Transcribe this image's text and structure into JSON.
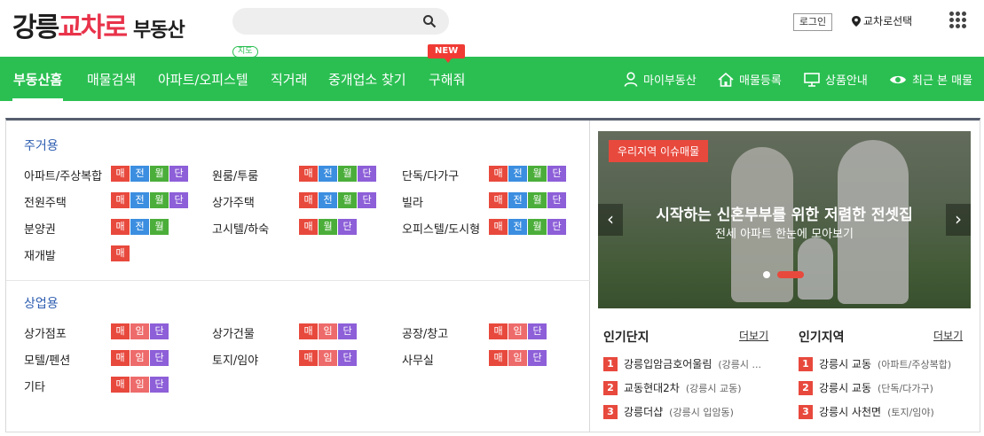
{
  "header": {
    "logo_part1": "강릉",
    "logo_part2": "교차로",
    "logo_part3": "부동산",
    "search_placeholder": "",
    "search_icon": "search-icon",
    "login_label": "로그인",
    "region_label": "교차로선택",
    "menu_icon": "grid-menu-icon"
  },
  "colors": {
    "brand_green": "#2bbf52",
    "brand_red": "#e8334a",
    "tag_sale": "#e8493d",
    "tag_jeonse": "#3c8ee0",
    "tag_monthly": "#4bae3a",
    "tag_short": "#8d5fd8",
    "tag_rent": "#ee6b6b",
    "section_blue": "#2d5db0"
  },
  "nav": {
    "items": [
      {
        "label": "부동산홈",
        "active": true
      },
      {
        "label": "매물검색"
      },
      {
        "label": "아파트/오피스텔",
        "badge": "지도"
      },
      {
        "label": "직거래"
      },
      {
        "label": "중개업소 찾기"
      },
      {
        "label": "구해줘",
        "badge": "NEW"
      }
    ],
    "right_items": [
      {
        "label": "마이부동산",
        "icon": "user-icon"
      },
      {
        "label": "매물등록",
        "icon": "house-icon"
      },
      {
        "label": "상품안내",
        "icon": "monitor-icon"
      },
      {
        "label": "최근 본 매물",
        "icon": "eye-icon"
      }
    ]
  },
  "residential": {
    "title": "주거용",
    "rows": [
      {
        "label": "아파트/주상복합",
        "tags": [
          "매",
          "전",
          "월",
          "단"
        ]
      },
      {
        "label": "원룸/투룸",
        "tags": [
          "매",
          "전",
          "월",
          "단"
        ]
      },
      {
        "label": "단독/다가구",
        "tags": [
          "매",
          "전",
          "월",
          "단"
        ]
      },
      {
        "label": "전원주택",
        "tags": [
          "매",
          "전",
          "월",
          "단"
        ]
      },
      {
        "label": "상가주택",
        "tags": [
          "매",
          "전",
          "월",
          "단"
        ]
      },
      {
        "label": "빌라",
        "tags": [
          "매",
          "전",
          "월",
          "단"
        ]
      },
      {
        "label": "분양권",
        "tags": [
          "매",
          "전",
          "월"
        ]
      },
      {
        "label": "고시텔/하숙",
        "tags": [
          "매",
          "월",
          "단"
        ]
      },
      {
        "label": "오피스텔/도시형",
        "tags": [
          "매",
          "전",
          "월",
          "단"
        ]
      },
      {
        "label": "재개발",
        "tags": [
          "매"
        ]
      }
    ]
  },
  "commercial": {
    "title": "상업용",
    "rows": [
      {
        "label": "상가점포",
        "tags": [
          "매",
          "임",
          "단"
        ]
      },
      {
        "label": "상가건물",
        "tags": [
          "매",
          "임",
          "단"
        ]
      },
      {
        "label": "공장/창고",
        "tags": [
          "매",
          "임",
          "단"
        ]
      },
      {
        "label": "모텔/펜션",
        "tags": [
          "매",
          "임",
          "단"
        ]
      },
      {
        "label": "토지/임야",
        "tags": [
          "매",
          "임",
          "단"
        ]
      },
      {
        "label": "사무실",
        "tags": [
          "매",
          "임",
          "단"
        ]
      },
      {
        "label": "기타",
        "tags": [
          "매",
          "임",
          "단"
        ]
      }
    ]
  },
  "banner": {
    "tag": "우리지역 이슈매물",
    "headline": "시작하는 신혼부부를 위한 저렴한 전셋집",
    "sub": "전세 아파트 한눈에 모아보기",
    "prev": "‹",
    "next": "›"
  },
  "popular_complex": {
    "title": "인기단지",
    "more": "더보기",
    "items": [
      {
        "rank": "1",
        "name": "강릉입암금호어울림",
        "loc": "(강릉시 ..."
      },
      {
        "rank": "2",
        "name": "교동현대2차",
        "loc": "(강릉시 교동)"
      },
      {
        "rank": "3",
        "name": "강릉더샵",
        "loc": "(강릉시 입암동)"
      }
    ]
  },
  "popular_region": {
    "title": "인기지역",
    "more": "더보기",
    "items": [
      {
        "rank": "1",
        "name": "강릉시 교동",
        "loc": "(아파트/주상복합)"
      },
      {
        "rank": "2",
        "name": "강릉시 교동",
        "loc": "(단독/다가구)"
      },
      {
        "rank": "3",
        "name": "강릉시 사천면",
        "loc": "(토지/임야)"
      }
    ]
  }
}
